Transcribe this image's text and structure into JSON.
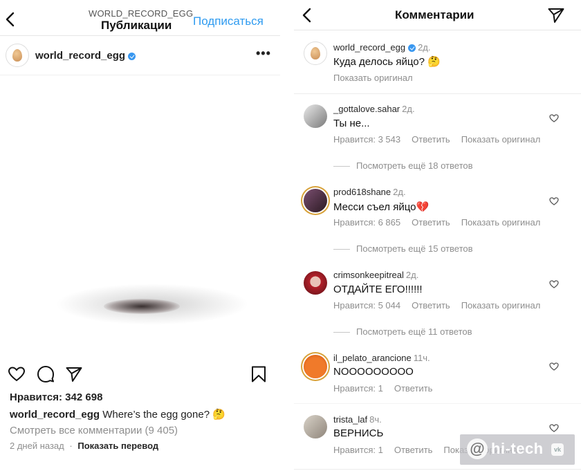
{
  "left": {
    "header": {
      "account_small": "WORLD_RECORD_EGG",
      "title": "Публикации",
      "subscribe": "Подписаться"
    },
    "post": {
      "account": "world_record_egg",
      "more": "•••",
      "likes": "Нравится: 342 698",
      "caption_user": "world_record_egg",
      "caption_text": "Where’s the egg gone? 🤔",
      "view_all": "Смотреть все комментарии (9 405)",
      "time": "2 дней назад",
      "separator": "·",
      "translate": "Показать перевод"
    }
  },
  "right": {
    "header": {
      "title": "Комментарии"
    },
    "comments": [
      {
        "user": "world_record_egg",
        "time": "2д.",
        "text": "Куда делось яйцо? 🤔",
        "show_original": "Показать оригинал"
      },
      {
        "user": "_gottalove.sahar",
        "time": "2д.",
        "text": "Ты не...",
        "likes": "Нравится: 3 543",
        "reply": "Ответить",
        "show_original": "Показать оригинал",
        "replies": "Посмотреть ещё 18 ответов"
      },
      {
        "user": "prod618shane",
        "time": "2д.",
        "text": "Месси съел яйцо💔",
        "likes": "Нравится: 6 865",
        "reply": "Ответить",
        "show_original": "Показать оригинал",
        "replies": "Посмотреть ещё 15 ответов"
      },
      {
        "user": "crimsonkeepitreal",
        "time": "2д.",
        "text": "ОТДАЙТЕ ЕГО!!!!!!",
        "likes": "Нравится: 5 044",
        "reply": "Ответить",
        "show_original": "Показать оригинал",
        "replies": "Посмотреть ещё 11 ответов"
      },
      {
        "user": "il_pelato_arancione",
        "time": "11ч.",
        "text": "NOOOOOOOOO",
        "likes": "Нравится: 1",
        "reply": "Ответить"
      },
      {
        "user": "trista_laf",
        "time": "8ч.",
        "text": "ВЕРНИСЬ",
        "likes": "Нравится: 1",
        "reply": "Ответить",
        "show_original": "Показать оригинал"
      }
    ]
  },
  "watermark": {
    "at": "@",
    "text": "hi-tech",
    "vk": "vk"
  },
  "icons": [
    "back-icon",
    "verified-icon",
    "more-icon",
    "heart-icon",
    "comment-icon",
    "send-icon",
    "bookmark-icon"
  ],
  "colors": {
    "accent": "#2f9bf0",
    "muted": "#8e8e8e",
    "verified": "#3897f0"
  }
}
